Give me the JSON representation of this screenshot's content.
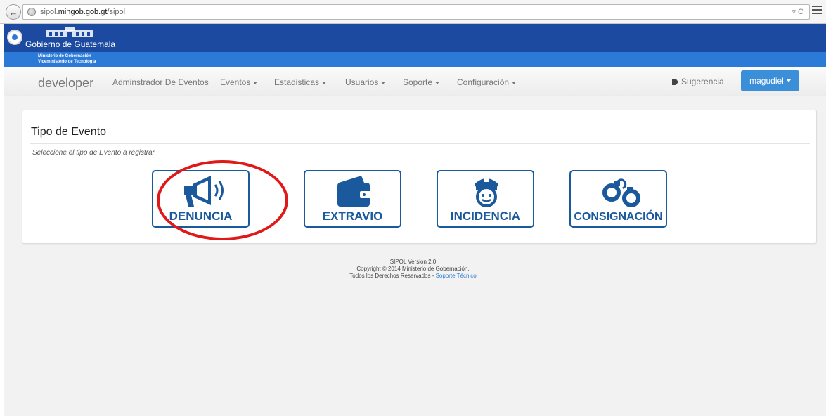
{
  "browser": {
    "url_prefix": "sipol.",
    "url_domain": "mingob.gob.gt",
    "url_path": "/sipol",
    "url_icons": "▿ C"
  },
  "banner": {
    "title": "Gobierno de Guatemala",
    "ministry_line1": "Ministerio de Gobernación",
    "ministry_line2": "Viceministerio de Tecnología",
    "colors": {
      "top": "#1c4aa0",
      "sub": "#2c7ad8"
    }
  },
  "nav": {
    "brand": "developer",
    "items": [
      {
        "label": "Adminstrador De Eventos",
        "dropdown": false
      },
      {
        "label": "Eventos",
        "dropdown": true
      },
      {
        "label": "Estadisticas",
        "dropdown": true
      },
      {
        "label": "Usuarios",
        "dropdown": true
      },
      {
        "label": "Soporte",
        "dropdown": true
      },
      {
        "label": "Configuración",
        "dropdown": true
      }
    ],
    "suggest": "Sugerencia",
    "user": "magudiel"
  },
  "panel": {
    "title": "Tipo de Evento",
    "subtitle": "Seleccione el tipo de Evento a registrar",
    "events": [
      {
        "label": "DENUNCIA",
        "icon": "megaphone-icon"
      },
      {
        "label": "EXTRAVIO",
        "icon": "wallet-icon"
      },
      {
        "label": "INCIDENCIA",
        "icon": "police-officer-icon"
      },
      {
        "label": "CONSIGNACIÓN",
        "icon": "handcuffs-icon"
      }
    ],
    "accent": "#1a5a9c",
    "highlight_color": "#e01818"
  },
  "footer": {
    "version": "SIPOL Version 2.0",
    "copyright": "Copyright © 2014 Ministerio de Gobernación.",
    "rights": "Todos los Derechos Reservados - ",
    "support_link": "Soporte Técnico"
  }
}
